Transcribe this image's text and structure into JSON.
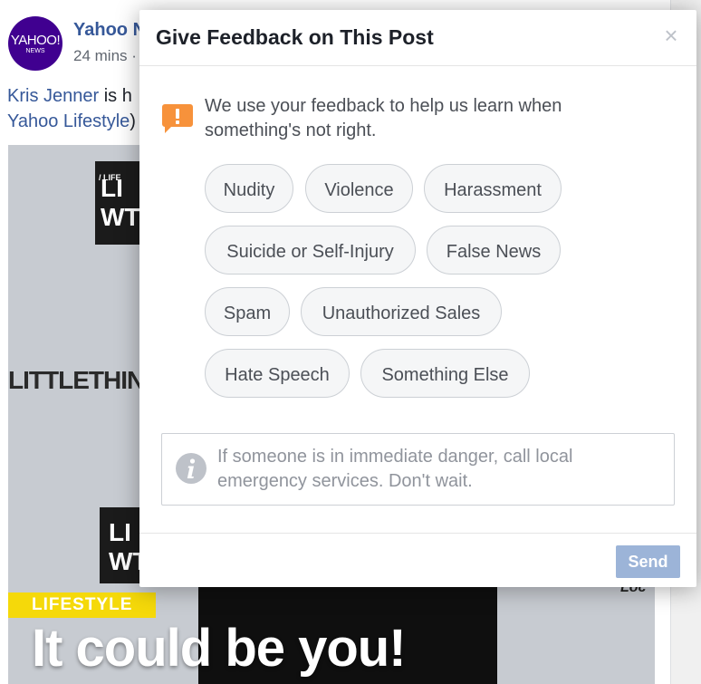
{
  "post": {
    "avatar_brand": "YAHOO!",
    "avatar_sub": "NEWS",
    "page_name": "Yahoo N",
    "time": "24 mins ·",
    "text_line1_link": "Kris Jenner",
    "text_line1_rest": " is h",
    "text_line2_link": "Yahoo Lifestyle",
    "text_line2_rest": ")",
    "image": {
      "sign_top_small": "/ LIFE",
      "sign_top_text": "LI WT",
      "wall_text": "LITTLETHING",
      "sign_mid_text": "LI WT",
      "right_mark": "Loc",
      "tag": "LIFESTYLE",
      "overlay_title": "It could be you!"
    }
  },
  "modal": {
    "title": "Give Feedback on This Post",
    "close_label": "×",
    "intro": "We use your feedback to help us learn when something's not right.",
    "options": [
      {
        "label": "Nudity"
      },
      {
        "label": "Violence"
      },
      {
        "label": "Harassment"
      },
      {
        "label": "Suicide or Self-Injury"
      },
      {
        "label": "False News"
      },
      {
        "label": "Spam"
      },
      {
        "label": "Unauthorized Sales"
      },
      {
        "label": "Hate Speech"
      },
      {
        "label": "Something Else"
      }
    ],
    "notice": "If someone is in immediate danger, call local emergency services. Don't wait.",
    "send_label": "Send"
  },
  "icons": {
    "intro_icon": "alert-speech-bubble-icon",
    "notice_icon": "info-circle-icon",
    "close_icon": "close-icon"
  },
  "colors": {
    "brand_blue": "#365899",
    "alert_orange": "#f7923b",
    "send_disabled": "#9cb4d8",
    "pill_background": "#f5f6f7",
    "yahoo_purple": "#400090"
  }
}
